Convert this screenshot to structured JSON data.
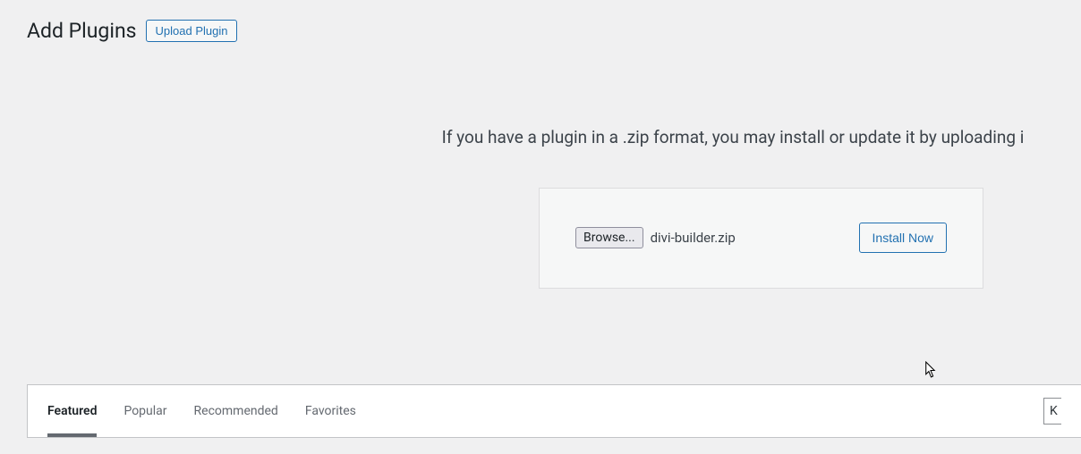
{
  "header": {
    "title": "Add Plugins",
    "upload_button": "Upload Plugin"
  },
  "upload": {
    "description": "If you have a plugin in a .zip format, you may install or update it by uploading i",
    "browse_label": "Browse...",
    "filename": "divi-builder.zip",
    "install_button": "Install Now"
  },
  "tabs": {
    "items": [
      {
        "label": "Featured",
        "active": true
      },
      {
        "label": "Popular",
        "active": false
      },
      {
        "label": "Recommended",
        "active": false
      },
      {
        "label": "Favorites",
        "active": false
      }
    ]
  },
  "search": {
    "partial_text": "K"
  }
}
